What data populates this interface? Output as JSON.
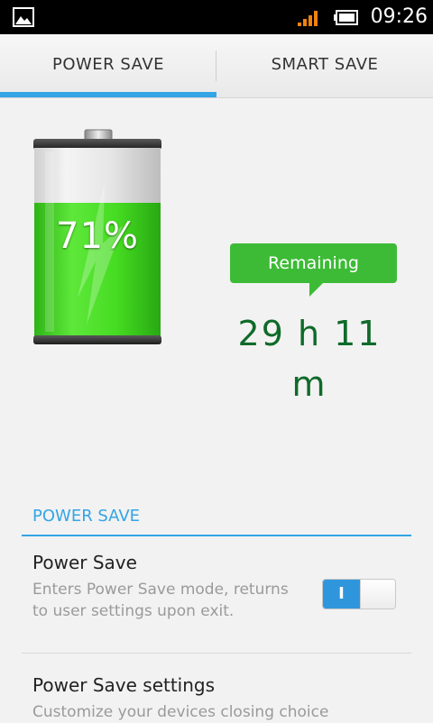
{
  "status_bar": {
    "time": "09:26",
    "icons": [
      "image-notification-icon",
      "signal-icon",
      "battery-icon"
    ]
  },
  "tabs": [
    {
      "label": "POWER SAVE",
      "selected": true
    },
    {
      "label": "SMART SAVE",
      "selected": false
    }
  ],
  "battery": {
    "level_text": "71%",
    "level": 0.71
  },
  "remaining": {
    "label": "Remaining",
    "time": "29 h 11 m"
  },
  "section": {
    "title": "POWER SAVE"
  },
  "items": [
    {
      "title": "Power Save",
      "description": "Enters Power Save mode, returns to user settings upon exit.",
      "toggle_label": "I",
      "toggle_on": true
    },
    {
      "title": "Power Save settings",
      "description": "Customize your devices closing choice"
    }
  ],
  "colors": {
    "accent": "#33a5e6",
    "bubble": "#3dbb36",
    "remaining_text": "#0f6a2a",
    "battery_green": "#3fd820"
  }
}
